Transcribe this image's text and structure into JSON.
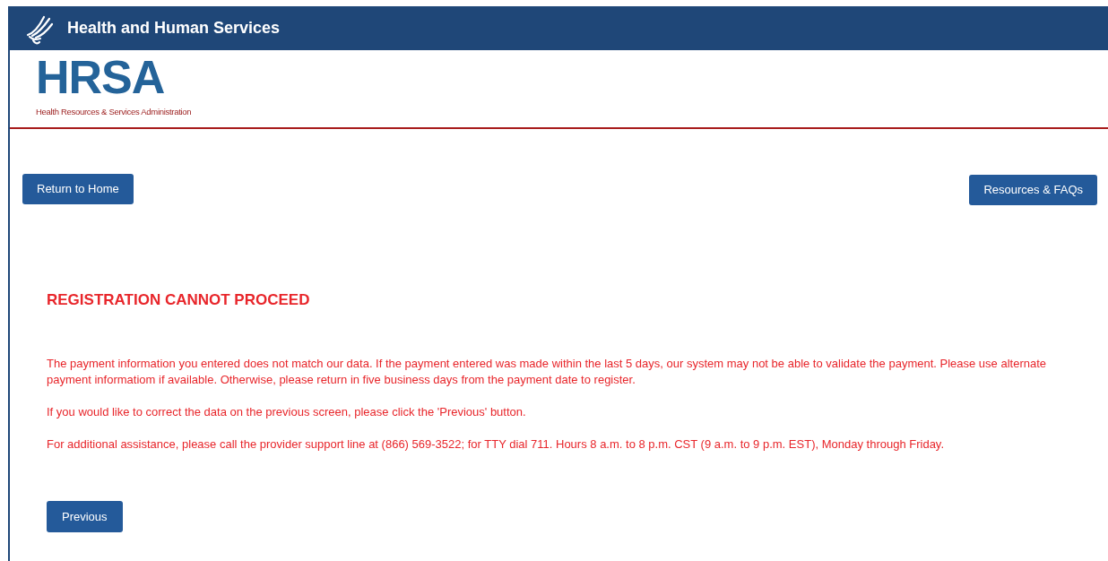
{
  "header": {
    "title": "Health and Human Services"
  },
  "logo": {
    "acronym": "HRSA",
    "tagline": "Health Resources & Services Administration"
  },
  "nav_buttons": [
    "Return to Home",
    "Resources & FAQs"
  ],
  "message": {
    "title": "REGISTRATION CANNOT PROCEED",
    "paragraphs": [
      "The payment information you entered does not match our data. If the payment entered was made within the last 5 days, our system may not be able to validate the payment. Please use alternate payment informatiom if available. Otherwise, please return in five business days from the payment date to register.",
      "If you would like to correct the data on the previous screen, please click the 'Previous' button.",
      "For additional assistance, please call the provider support line at (866) 569-3522; for TTY dial 711. Hours 8 a.m. to 8 p.m. CST (9 a.m. to 9 p.m. EST), Monday through Friday."
    ]
  },
  "footer_button": "Previous"
}
